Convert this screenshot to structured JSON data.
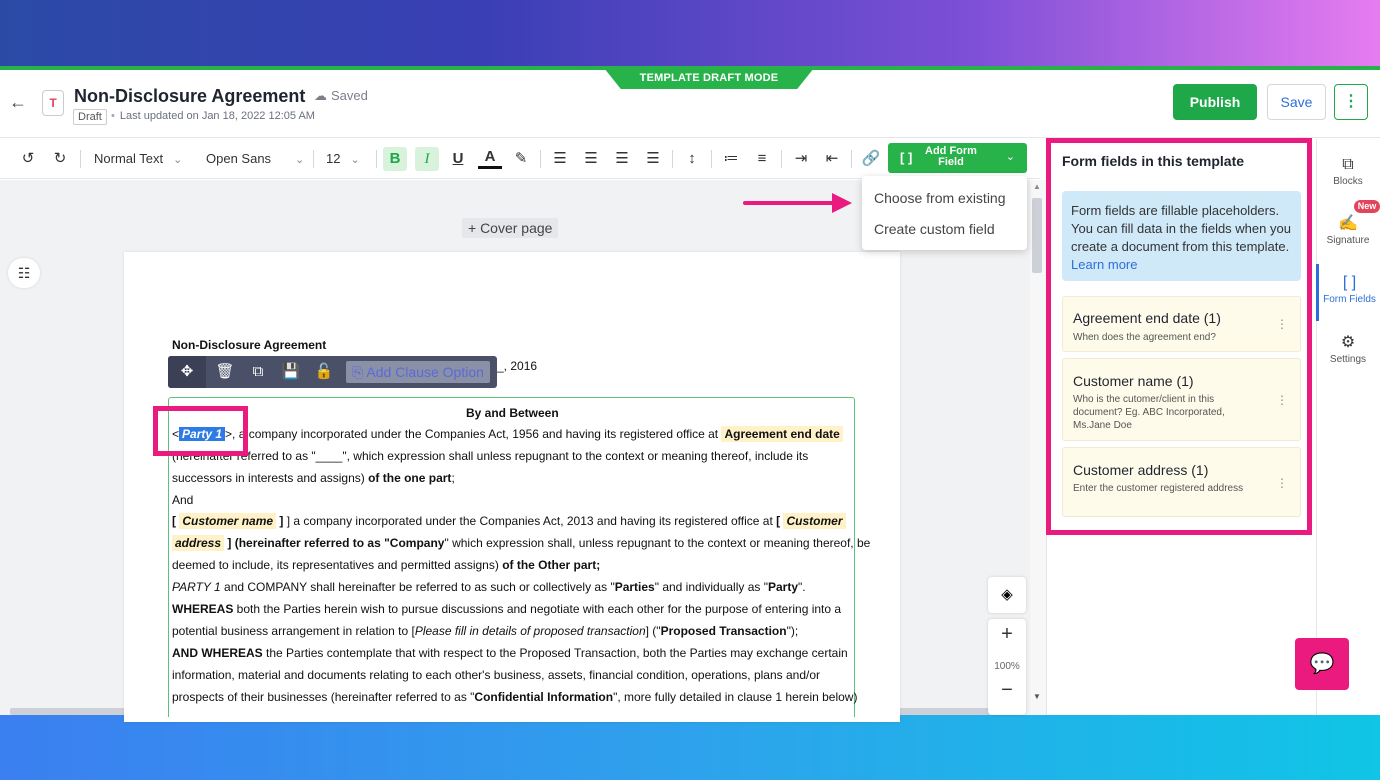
{
  "header": {
    "mode_label": "TEMPLATE DRAFT MODE",
    "doc_icon_letter": "T",
    "title": "Non-Disclosure Agreement",
    "saved_status": "Saved",
    "draft_badge": "Draft",
    "updated": "Last updated on Jan 18, 2022 12:05 AM",
    "publish_label": "Publish",
    "save_label": "Save"
  },
  "toolbar": {
    "style": "Normal Text",
    "font": "Open Sans",
    "size": "12",
    "add_form_field": "Add Form Field"
  },
  "dropdown": {
    "items": [
      "Choose from existing",
      "Create custom field"
    ]
  },
  "canvas": {
    "cover_page": "+ Cover page",
    "zoom": "100%"
  },
  "clause_toolbar": {
    "add_option": "Add Clause Option"
  },
  "document": {
    "heading": "Non-Disclosure Agreement",
    "year_suffix": "_, 2016",
    "by_between": "By and Between",
    "party_open": "<",
    "party_chip": "Party 1",
    "line1_rest": ">, a company incorporated under the Companies Act, 1956 and having its registered office at ",
    "agreement_end_date": "Agreement end date",
    "line2": "(hereinafter referred to as \"____\", which expression shall unless repugnant to the context or meaning thereof, include its",
    "line3_a": "successors in interests and assigns) ",
    "line3_b": "of the one part",
    "line3_c": ";",
    "line4": "And",
    "line5_open": "[ ",
    "customer_name": "Customer name",
    "line5_mid": " ] a company incorporated under the Companies Act, 2013 and having its registered office at ",
    "line5_bracket": "[ ",
    "customer_address_1": "Customer",
    "customer_address_2": "address",
    "line6_a": " ] (hereinafter referred to as \"",
    "line6_company": "Company",
    "line6_b": "\" which expression shall, unless repugnant to the context or meaning thereof, be",
    "line7_a": "deemed to include, its representatives and permitted assigns) ",
    "line7_b": "of the Other part;",
    "line8_a": "PARTY 1",
    "line8_b": " and COMPANY shall hereinafter be referred to as such or collectively as \"",
    "line8_parties": "Parties",
    "line8_c": "\" and individually as \"",
    "line8_party": "Party",
    "line8_d": "\".",
    "line9_a": "WHEREAS",
    "line9_b": " both the Parties herein wish to pursue discussions and negotiate with each other for the purpose of entering into a",
    "line10_a": "potential business arrangement in relation to [",
    "line10_b": "Please fill in details of proposed transaction",
    "line10_c": "] (\"",
    "line10_d": "Proposed Transaction",
    "line10_e": "\");",
    "line11_a": "AND WHEREAS",
    "line11_b": " the Parties contemplate that with respect to the Proposed Transaction, both the Parties may exchange certain",
    "line12": "information, material and documents relating to each other's business, assets, financial condition, operations, plans and/or",
    "line13_a": "prospects of their businesses (hereinafter referred to as \"",
    "line13_b": "Confidential Information",
    "line13_c": "\", more fully detailed in clause 1 herein below)"
  },
  "panel": {
    "title": "Form fields in this template",
    "info": "Form fields are fillable placeholders. You can fill data in the fields when you create a document from this template.",
    "learn_more": "Learn more",
    "fields": [
      {
        "name": "Agreement end date (1)",
        "desc": "When does the agreement end?"
      },
      {
        "name": "Customer name (1)",
        "desc": "Who is the cutomer/client in this document? Eg. ABC Incorporated, Ms.Jane Doe"
      },
      {
        "name": "Customer address (1)",
        "desc": "Enter the customer registered address"
      }
    ]
  },
  "rail": {
    "new_badge": "New",
    "items": [
      "Blocks",
      "Signature",
      "Form Fields",
      "Settings"
    ]
  },
  "colors": {
    "accent_green": "#27b24a",
    "highlight_pink": "#ea1a7f",
    "link_blue": "#2e6fd8",
    "chip_yellow": "#fff2c8"
  }
}
